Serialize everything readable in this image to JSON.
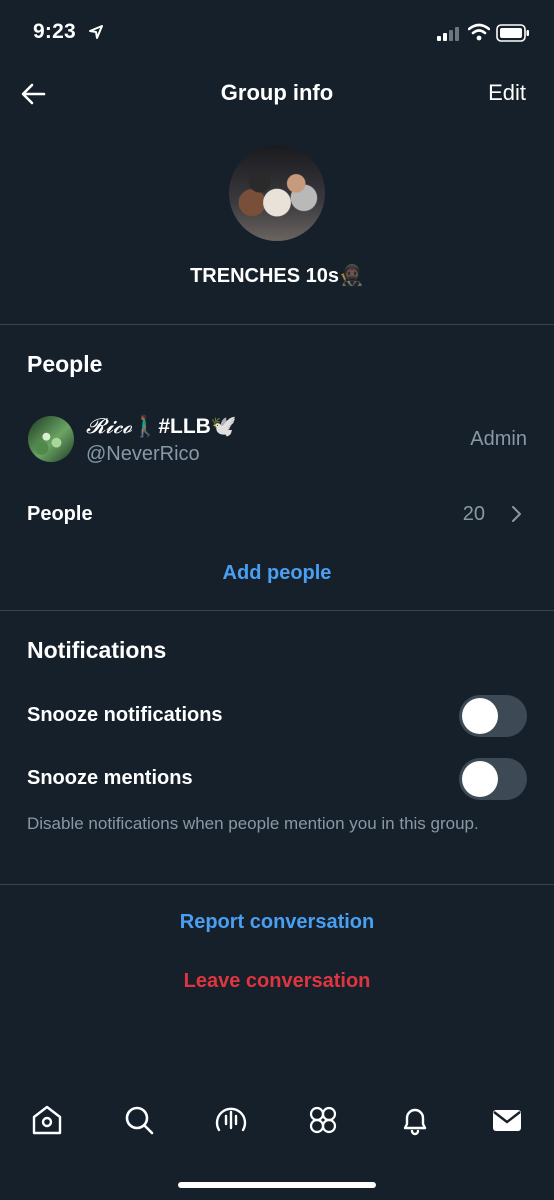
{
  "status_bar": {
    "time": "9:23"
  },
  "header": {
    "title": "Group info",
    "edit_label": "Edit"
  },
  "group": {
    "name": "TRENCHES 10s🥷🏿"
  },
  "people_section": {
    "title": "People",
    "member": {
      "name_script": "𝓡𝓲𝓬𝓸",
      "name_rest": "🚶🏾‍♂️#LLB🕊️",
      "handle": "@NeverRico",
      "role": "Admin"
    },
    "people_label": "People",
    "people_count": "20",
    "add_people_label": "Add people"
  },
  "notifications_section": {
    "title": "Notifications",
    "snooze_notifications_label": "Snooze notifications",
    "snooze_notifications_on": false,
    "snooze_mentions_label": "Snooze mentions",
    "snooze_mentions_on": false,
    "hint": "Disable notifications when people mention you in this group."
  },
  "actions": {
    "report_label": "Report conversation",
    "leave_label": "Leave conversation"
  },
  "colors": {
    "background": "#15202b",
    "divider": "#38444d",
    "accent_blue": "#1d9bf0",
    "danger_red": "#e0353f",
    "muted": "#8899a6"
  },
  "tab_bar": {
    "icons": [
      "home-icon",
      "search-icon",
      "spaces-icon",
      "communities-icon",
      "notifications-icon",
      "messages-icon"
    ],
    "active": "messages-icon"
  }
}
